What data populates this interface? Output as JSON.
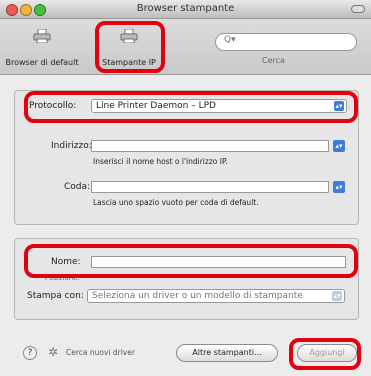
{
  "window": {
    "title": "Browser stampante",
    "traffic_colors": [
      "#ef5b52",
      "#f0b43b",
      "#46c03f"
    ]
  },
  "toolbar": {
    "default_browser_label": "Browser di default",
    "ip_printer_label": "Stampante IP",
    "search_glyph": "Q▾",
    "search_label": "Cerca"
  },
  "protocol_section": {
    "protocol_label": "Protocollo:",
    "protocol_value": "Line Printer Daemon – LPD",
    "address_label": "Indirizzo:",
    "address_value": "",
    "address_hint": "Inserisci il nome host o l'indirizzo IP.",
    "queue_label": "Coda:",
    "queue_value": "",
    "queue_hint": "Lascia uno spazio vuoto per coda di default."
  },
  "name_section": {
    "name_label": "Nome:",
    "name_value": "",
    "location_label": "Posizione:",
    "print_with_label": "Stampa con:",
    "print_with_value": "Seleziona un driver o un modello di stampante"
  },
  "bottom": {
    "help_glyph": "?",
    "gear_glyph": "✲",
    "status_text": "Cerca nuovi driver",
    "more_printers_label": "Altre stampanti...",
    "add_label": "Aggiungi"
  },
  "accent_color": "#e3000f"
}
